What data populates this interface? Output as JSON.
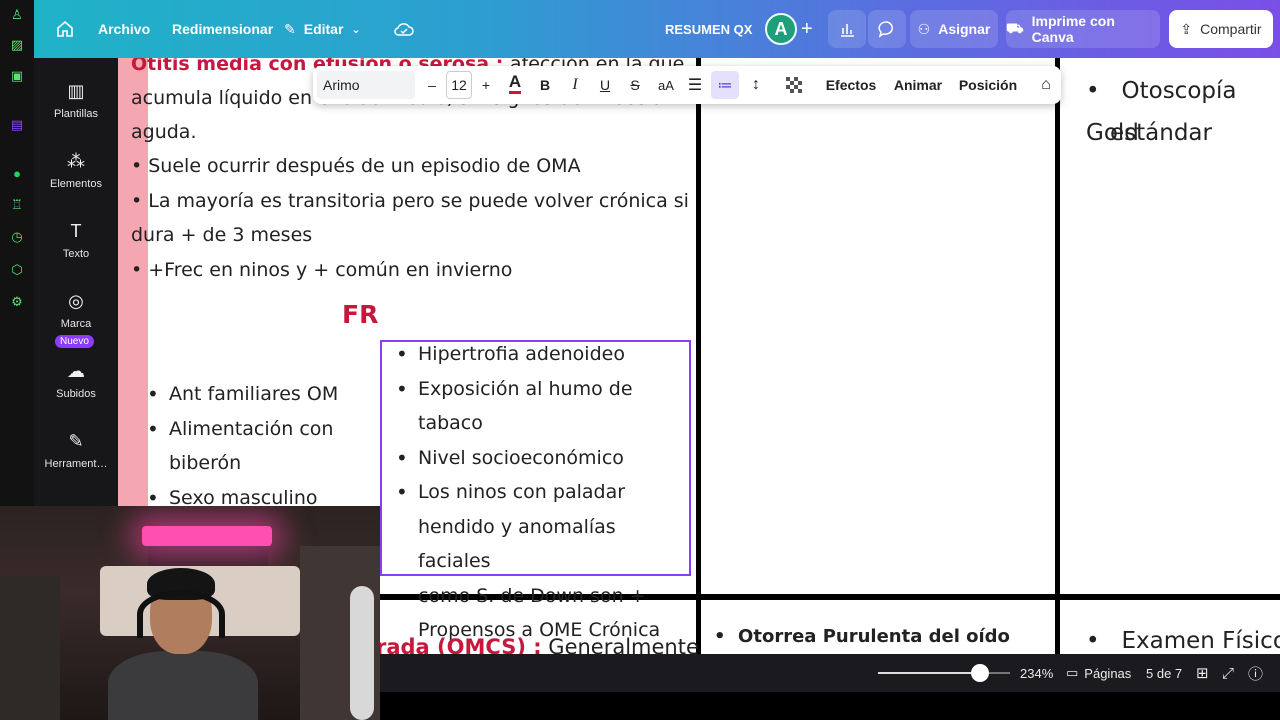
{
  "topbar": {
    "home_icon": "home-icon",
    "file": "Archivo",
    "resize": "Redimensionar",
    "edit": "Editar",
    "doc_title": "RESUMEN QX",
    "avatar_letter": "A",
    "assign": "Asignar",
    "print": "Imprime con Canva",
    "share": "Compartir",
    "gradient_start": "#1fb3c7",
    "gradient_end": "#7a4fe6"
  },
  "sidebar": {
    "items": [
      {
        "label": "Plantillas",
        "icon": "template-icon"
      },
      {
        "label": "Elementos",
        "icon": "shapes-icon"
      },
      {
        "label": "Texto",
        "icon": "text-icon"
      },
      {
        "label": "Marca",
        "icon": "brand-icon"
      },
      {
        "label": "Subidos",
        "icon": "upload-icon"
      },
      {
        "label": "Herrament…",
        "icon": "tools-icon"
      }
    ],
    "new_badge": "Nuevo"
  },
  "text_toolbar": {
    "font": "Arimo",
    "size": "12",
    "minus": "–",
    "plus": "+",
    "bold": "B",
    "italic": "I",
    "underline": "U",
    "strike": "S",
    "case": "aA",
    "effects": "Efectos",
    "animate": "Animar",
    "position": "Posición"
  },
  "document": {
    "heading_partial": "Otitis media con efusión o serosa",
    "intro_colon": " : ",
    "intro_1": "afección en la que se",
    "intro_2": "acumula líquido en el oído medio, sin signos de  infección",
    "intro_3": "aguda.",
    "b1": "Suele ocurrir después de un episodio de OMA",
    "b2a": "La mayoría es transitoria pero se puede volver crónica si",
    "b2b": "dura + de 3 meses",
    "b3": "+Frec en ninos y + común en invierno",
    "fr_title": "FR",
    "left_list": [
      "Ant familiares OM",
      "Alimentación con",
      "biberón",
      "Sexo masculino"
    ],
    "box_list": [
      "Hipertrofia adenoideo",
      "Exposición al humo de tabaco",
      "Nivel socioeconómico",
      "Los ninos con paladar",
      "hendido y anomalías faciales",
      "como S. de Down son +",
      "Propensos a OME Crónica"
    ],
    "right_col_1": "Otoscopía Gold",
    "right_col_2": "estándar",
    "bottom_red": "rada (OMCS) :",
    "bottom_red_rest": " Generalmente",
    "bottom_mid": "Otorrea Purulenta  del oído",
    "bottom_right": "Examen Físico",
    "accent_red": "#c6183d",
    "selection_color": "#8b3dff"
  },
  "statusbar": {
    "zoom": "234%",
    "pages_label": "Páginas",
    "page_indicator": "5 de 7",
    "zoom_fraction": 0.77
  }
}
